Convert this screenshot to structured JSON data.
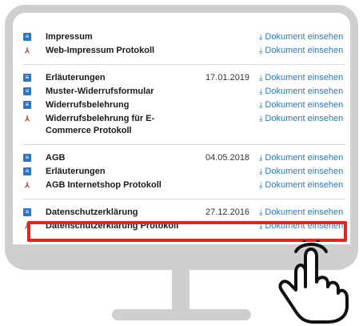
{
  "groups": [
    {
      "rows": [
        {
          "icon": "doc",
          "title": "Impressum",
          "date": "",
          "link": "Dokument einsehen"
        },
        {
          "icon": "pdf",
          "title": "Web-Impressum Protokoll",
          "date": "",
          "link": "Dokument einsehen"
        }
      ]
    },
    {
      "rows": [
        {
          "icon": "doc",
          "title": "Erläuterungen",
          "date": "17.01.2019",
          "link": "Dokument einsehen"
        },
        {
          "icon": "doc",
          "title": "Muster-Widerrufsformular",
          "date": "",
          "link": "Dokument einsehen"
        },
        {
          "icon": "doc",
          "title": "Widerrufsbelehrung",
          "date": "",
          "link": "Dokument einsehen"
        },
        {
          "icon": "pdf",
          "title": "Widerrufsbelehrung für E-Commerce Protokoll",
          "date": "",
          "link": "Dokument einsehen"
        }
      ]
    },
    {
      "rows": [
        {
          "icon": "doc",
          "title": "AGB",
          "date": "04.05.2018",
          "link": "Dokument einsehen"
        },
        {
          "icon": "doc",
          "title": "Erläuterungen",
          "date": "",
          "link": "Dokument einsehen"
        },
        {
          "icon": "pdf",
          "title": "AGB Internetshop Protokoll",
          "date": "",
          "link": "Dokument einsehen"
        }
      ]
    },
    {
      "rows": [
        {
          "icon": "doc",
          "title": "Datenschutzerklärung",
          "date": "27.12.2016",
          "link": "Dokument einsehen"
        },
        {
          "icon": "pdf",
          "title": "Datenschutzerklärung Protokoll",
          "date": "",
          "link": "Dokument einsehen"
        }
      ]
    }
  ],
  "colors": {
    "link": "#2a78c5",
    "highlight": "#e52222",
    "pdf": "#d01b1b"
  }
}
